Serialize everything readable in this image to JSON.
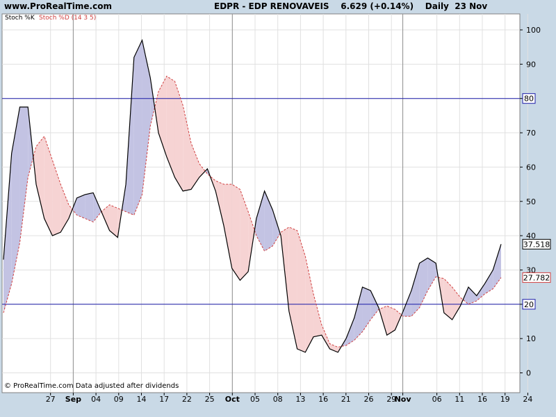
{
  "header": {
    "site": "www.ProRealTime.com",
    "title": "EDPR - EDP RENOVAVEIS    6.629 (+0.14%)    Daily  23 Nov"
  },
  "chart_data": {
    "type": "line",
    "legend": {
      "k_label": "Stoch %K",
      "d_label": "Stoch %D (14 3 5)",
      "placement": "top-left"
    },
    "footer": "© ProRealTime.com  Data adjusted after dividends",
    "ylim": [
      -5,
      103
    ],
    "yticks": [
      0,
      10,
      20,
      30,
      40,
      50,
      60,
      70,
      80,
      90,
      100
    ],
    "hlines": [
      {
        "value": 80,
        "label": "80",
        "color": "#1a1aa8"
      },
      {
        "value": 20,
        "label": "20",
        "color": "#1a1aa8"
      }
    ],
    "last_values": [
      {
        "value": 37.518,
        "label": "37.518",
        "color": "#000000"
      },
      {
        "value": 27.782,
        "label": "27.782",
        "color": "#d04040"
      }
    ],
    "x_ticks": [
      {
        "i": 2,
        "label": "27",
        "bold": false
      },
      {
        "i": 4,
        "label": "Sep",
        "bold": true
      },
      {
        "i": 6,
        "label": "04",
        "bold": false
      },
      {
        "i": 8,
        "label": "09",
        "bold": false
      },
      {
        "i": 10,
        "label": "14",
        "bold": false
      },
      {
        "i": 12,
        "label": "17",
        "bold": false
      },
      {
        "i": 14,
        "label": "22",
        "bold": false
      },
      {
        "i": 16,
        "label": "25",
        "bold": false
      },
      {
        "i": 18,
        "label": "Oct",
        "bold": true
      },
      {
        "i": 20,
        "label": "05",
        "bold": false
      },
      {
        "i": 22,
        "label": "08",
        "bold": false
      },
      {
        "i": 24,
        "label": "13",
        "bold": false
      },
      {
        "i": 26,
        "label": "16",
        "bold": false
      },
      {
        "i": 28,
        "label": "21",
        "bold": false
      },
      {
        "i": 30,
        "label": "26",
        "bold": false
      },
      {
        "i": 32,
        "label": "29",
        "bold": false
      },
      {
        "i": 33,
        "label": "Nov",
        "bold": true
      },
      {
        "i": 36,
        "label": "06",
        "bold": false
      },
      {
        "i": 38,
        "label": "11",
        "bold": false
      },
      {
        "i": 40,
        "label": "16",
        "bold": false
      },
      {
        "i": 42,
        "label": "19",
        "bold": false
      },
      {
        "i": 44,
        "label": "24",
        "bold": false
      }
    ],
    "month_lines": [
      4,
      18,
      33
    ],
    "series": [
      {
        "name": "Stoch %K",
        "color": "#000000",
        "values": [
          33,
          64,
          77.5,
          77.5,
          55,
          45,
          40,
          41,
          45,
          51,
          52,
          52.5,
          47,
          41.5,
          39.5,
          55,
          92,
          97,
          86,
          70,
          63,
          57,
          53,
          53.5,
          57,
          59.5,
          53,
          43,
          30.5,
          27,
          29.5,
          45,
          53,
          47.5,
          40,
          18,
          7,
          6,
          10.5,
          11,
          7,
          6,
          10,
          16,
          25,
          24,
          19,
          11,
          12.5,
          18,
          24,
          32,
          33.5,
          32,
          17.5,
          15.5,
          19.5,
          25,
          22.5,
          26,
          30,
          37.518
        ]
      },
      {
        "name": "Stoch %D (14 3 5)",
        "color": "#d04040",
        "values": [
          17.5,
          26,
          38,
          57,
          66,
          69,
          62,
          55,
          49,
          46,
          45,
          44,
          47,
          49,
          48,
          47,
          46,
          52,
          72,
          82,
          86.5,
          85,
          78,
          67,
          61,
          58,
          56,
          55,
          55,
          53.5,
          47,
          40,
          35.5,
          37,
          41,
          42.5,
          41.5,
          34,
          23,
          14,
          8.5,
          7.5,
          8,
          9.5,
          12,
          15.5,
          18.5,
          19.5,
          18.5,
          16.5,
          16.5,
          19,
          24,
          28,
          27.5,
          25,
          22,
          20,
          21,
          23,
          24.5,
          27.782
        ]
      }
    ]
  }
}
